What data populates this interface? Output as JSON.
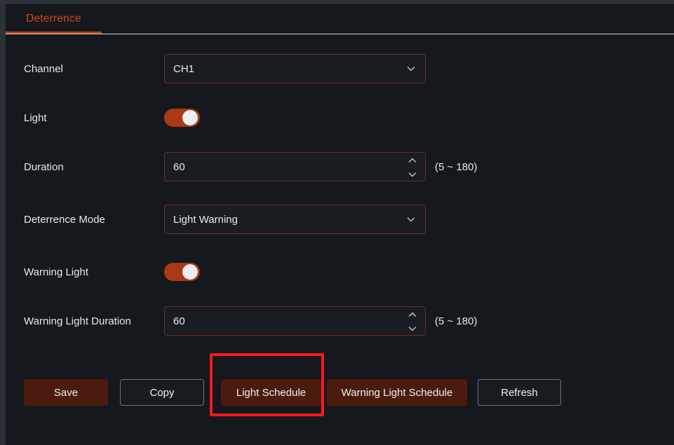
{
  "tabs": [
    {
      "label": "Deterrence",
      "active": true
    }
  ],
  "form": {
    "rows": [
      {
        "label": "Channel",
        "type": "select"
      },
      {
        "label": "Light",
        "type": "toggle"
      },
      {
        "label": "Duration",
        "type": "number"
      },
      {
        "label": "Deterrence Mode",
        "type": "select"
      },
      {
        "label": "Warning Light",
        "type": "toggle"
      },
      {
        "label": "Warning Light Duration",
        "type": "number"
      }
    ],
    "channel": {
      "label": "Channel",
      "value": "CH1",
      "options": [
        "CH1"
      ],
      "icon": "chevron-down-icon"
    },
    "light": {
      "label": "Light",
      "state": "on"
    },
    "duration": {
      "label": "Duration",
      "value": "60",
      "placeholder": "60",
      "hint": "(5 ~ 180)",
      "spinner_up_icon": "chevron-up-icon",
      "spinner_down_icon": "chevron-down-icon"
    },
    "deterrence_mode": {
      "label": "Deterrence Mode",
      "value": "Light Warning",
      "options": [
        "Light Warning"
      ],
      "icon": "chevron-down-icon"
    },
    "warning_light": {
      "label": "Warning Light",
      "state": "on"
    },
    "warning_light_duration": {
      "label": "Warning Light Duration",
      "value": "60",
      "placeholder": "60",
      "hint": "(5 ~ 180)",
      "spinner_up_icon": "chevron-up-icon",
      "spinner_down_icon": "chevron-down-icon"
    }
  },
  "buttons": {
    "save": "Save",
    "copy": "Copy",
    "light_schedule": "Light Schedule",
    "warning_light_schedule": "Warning Light Schedule",
    "refresh": "Refresh"
  },
  "annotation": {
    "target": "Light Schedule",
    "color": "#ff1a1a"
  },
  "colors": {
    "accent": "#c0421a",
    "tab_text": "#d1441b",
    "toggle_on": "#ab3915",
    "button_filled": "#4b1c0d",
    "panel_bg": "#15181c",
    "input_border": "#6b3320",
    "outline_border": "#6f7478",
    "text": "#e7e9eb",
    "annotation": "#ff1a1a"
  }
}
